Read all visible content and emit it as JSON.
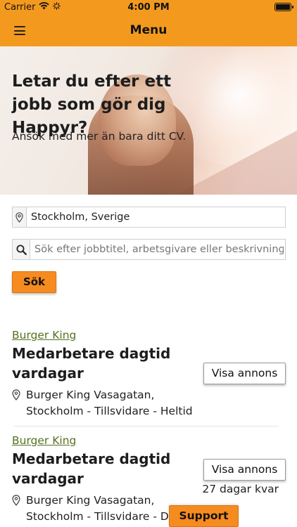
{
  "status_bar": {
    "carrier": "Carrier",
    "time": "4:00 PM"
  },
  "nav": {
    "title": "Menu",
    "menu_icon": "hamburger-icon"
  },
  "hero": {
    "title_line1": "Letar du efter ett",
    "title_line2": "jobb som gör dig Happyr?",
    "subtitle": "Ansök med mer än bara ditt CV."
  },
  "search": {
    "location_value": "Stockholm, Sverige",
    "query_placeholder": "Sök efter jobbtitel, arbetsgivare eller beskrivning",
    "submit_label": "Sök"
  },
  "jobs": [
    {
      "company": "Burger King",
      "title": "Medarbetare dagtid vardagar",
      "location_line1": "Burger King Vasagatan,",
      "location_line2": "Stockholm - Tillsvidare - Heltid",
      "button_label": "Visa annons",
      "days_left": ""
    },
    {
      "company": "Burger King",
      "title": "Medarbetare dagtid vardagar",
      "location_line1": "Burger King Vasagatan,",
      "location_line2": "Stockholm - Tillsvidare - Deltid",
      "button_label": "Visa annons",
      "days_left": "27 dagar kvar"
    }
  ],
  "support_label": "Support",
  "colors": {
    "accent": "#f39a1e",
    "button": "#f68b1f",
    "company_link": "#55701f"
  }
}
